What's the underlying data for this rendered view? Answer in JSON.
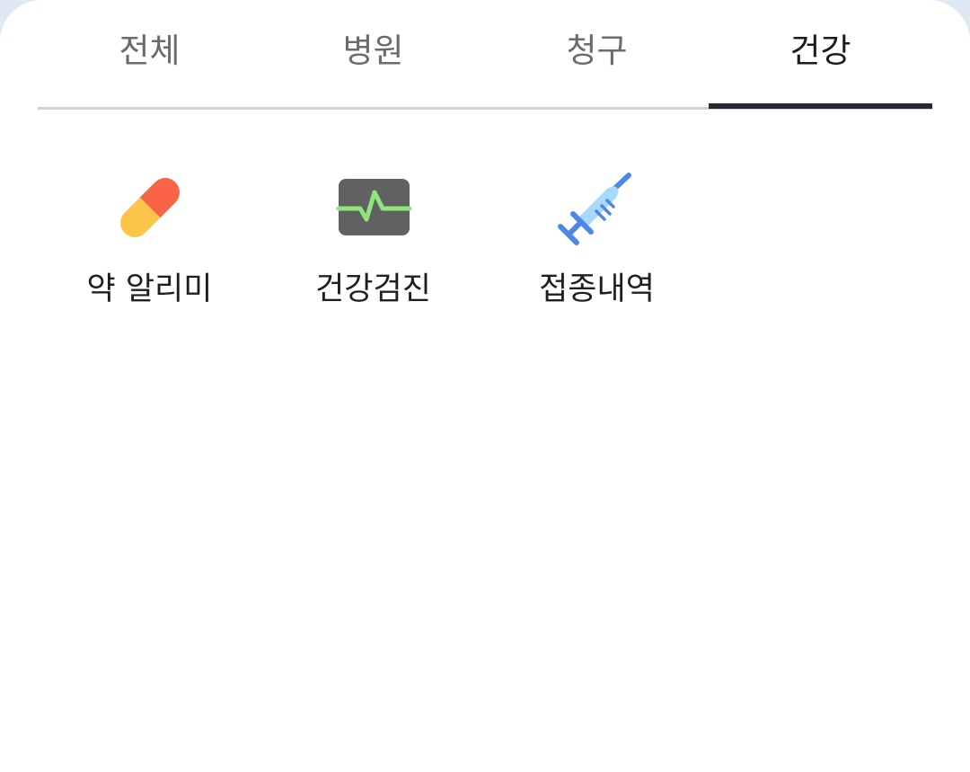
{
  "tabs": [
    {
      "label": "전체",
      "active": false
    },
    {
      "label": "병원",
      "active": false
    },
    {
      "label": "청구",
      "active": false
    },
    {
      "label": "건강",
      "active": true
    }
  ],
  "menu": [
    {
      "label": "약 알리미",
      "icon": "pill-icon"
    },
    {
      "label": "건강검진",
      "icon": "heartbeat-monitor-icon"
    },
    {
      "label": "접종내역",
      "icon": "syringe-icon"
    }
  ],
  "colors": {
    "active_underline": "#262a33",
    "pill_red": "#fa6346",
    "pill_yellow": "#fcc64a",
    "monitor_body": "#616161",
    "monitor_line": "#8ee57a",
    "syringe_light": "#a8d8fb",
    "syringe_dark": "#4e87e8"
  }
}
